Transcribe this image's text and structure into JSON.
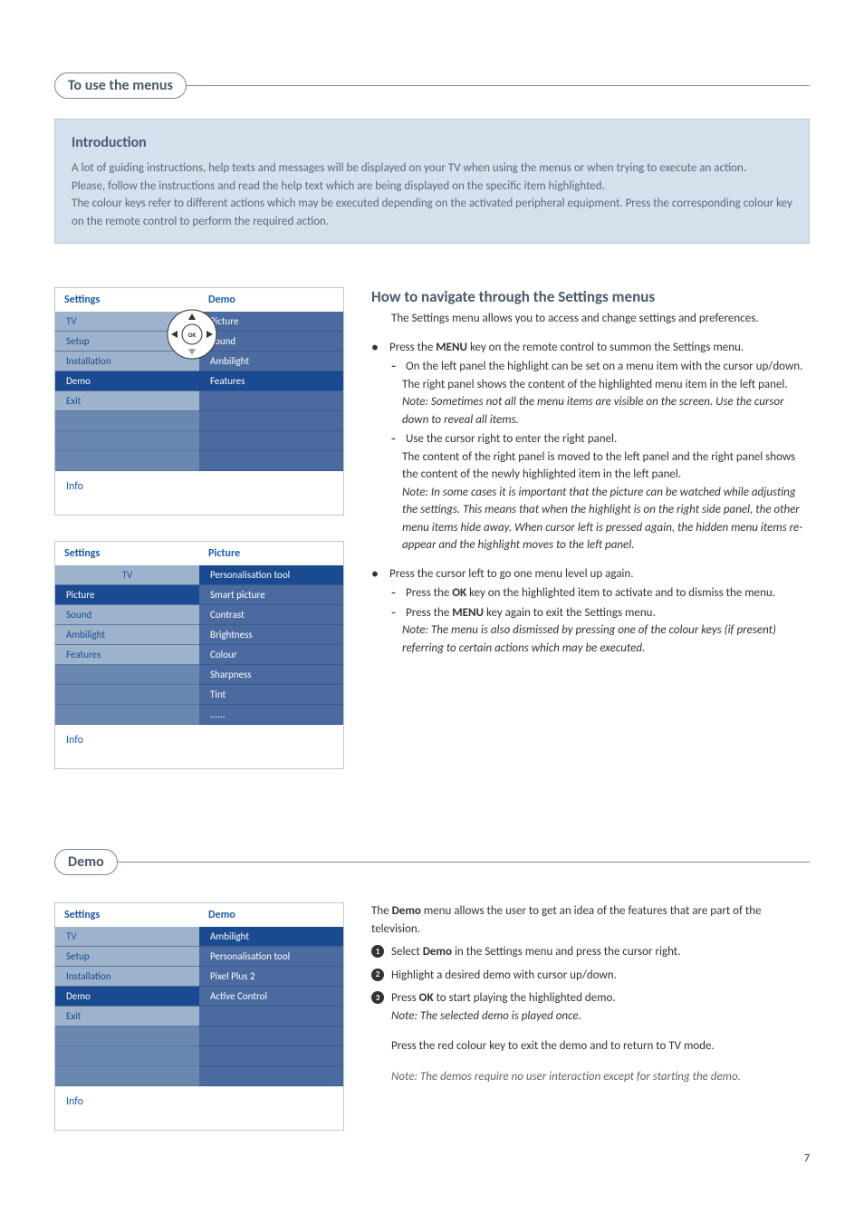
{
  "page_number": "7",
  "section1": {
    "pill": "To use the menus",
    "intro_heading": "Introduction",
    "intro_p1": "A lot of guiding instructions, help texts and messages will be displayed on your TV when using the menus or when trying to execute an action.",
    "intro_p2": "Please, follow the instructions and read the help text which are being displayed on the specific item highlighted.",
    "intro_p3": "The colour keys refer to different actions which may be executed depending on the activated peripheral equipment. Press the corresponding colour key on the remote control to perform the required action."
  },
  "menu1": {
    "left_title": "Settings",
    "right_title": "Demo",
    "left_items": [
      "TV",
      "Setup",
      "Installation",
      "Demo",
      "Exit"
    ],
    "right_items": [
      "Picture",
      "Sound",
      "Ambilight",
      "Features"
    ],
    "info": "Info"
  },
  "menu2": {
    "left_title": "Settings",
    "right_title": "Picture",
    "tv_label": "TV",
    "left_items": [
      "Picture",
      "Sound",
      "Ambilight",
      "Features"
    ],
    "right_items": [
      "Personalisation tool",
      "Smart picture",
      "Contrast",
      "Brightness",
      "Colour",
      "Sharpness",
      "Tint",
      "......"
    ],
    "info": "Info"
  },
  "howto": {
    "heading": "How to navigate through the Settings menus",
    "p1": "The Settings menu allows you to access and change settings and preferences.",
    "b1": "Press the MENU key on the remote control to summon the Settings menu.",
    "b1_s1": "On the left panel the highlight can be set on a menu item with the cursor up/down.",
    "b1_s1b": "The right panel shows the content of the highlighted menu item in the left panel.",
    "b1_note": "Note: Sometimes not all the menu items are visible on the screen. Use the cursor down to reveal all items.",
    "b1_s2": "Use the cursor right to enter the right panel.",
    "b1_s2b": "The content of the right panel is moved to the left panel and the right panel shows the content of the newly highlighted item in the left panel.",
    "b1_s2note": "Note: In some cases it is important that the picture can be watched while adjusting the settings. This means that when the highlight is on the right side panel, the other menu items hide away. When cursor left is pressed again, the hidden menu items re-appear and the highlight moves to the left panel.",
    "b2": "Press the cursor left to go one menu level up again.",
    "b2_s1": "Press the OK key on the highlighted item to activate and to dismiss the menu.",
    "b2_s2": "Press the MENU key again to exit the Settings menu.",
    "b2_note": "Note: The menu is also dismissed by pressing one of the colour keys (if present) referring to certain actions which may be executed."
  },
  "section2": {
    "pill": "Demo"
  },
  "menu3": {
    "left_title": "Settings",
    "right_title": "Demo",
    "left_items": [
      "TV",
      "Setup",
      "Installation",
      "Demo",
      "Exit"
    ],
    "right_items": [
      "Ambilight",
      "Personalisation tool",
      "Pixel Plus 2",
      "Active Control"
    ],
    "info": "Info"
  },
  "demo": {
    "p1": "The Demo menu allows the user to get an idea of the features that are part of the television.",
    "s1": "Select Demo in the Settings menu and press the cursor right.",
    "s2": "Highlight a desired demo with cursor up/down.",
    "s3": "Press OK to start playing the highlighted demo.",
    "s3_note": "Note: The selected demo is played once.",
    "p2": "Press the red colour key to exit the demo and to return to TV mode.",
    "p2_note": "Note: The demos require no user interaction except for starting the demo."
  }
}
